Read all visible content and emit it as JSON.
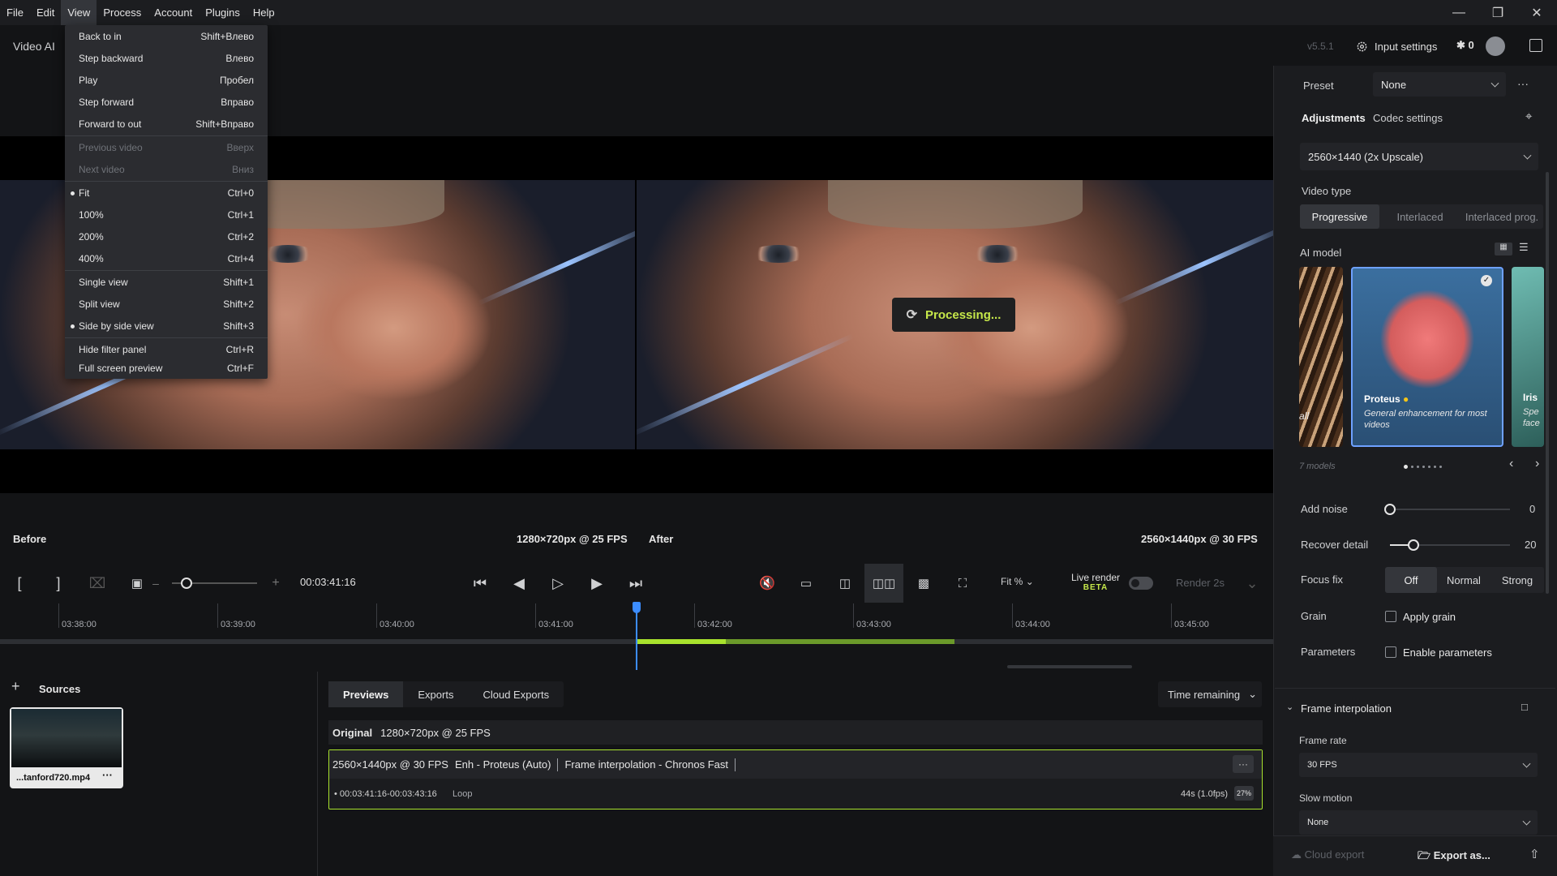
{
  "menubar": {
    "items": [
      "File",
      "Edit",
      "View",
      "Process",
      "Account",
      "Plugins",
      "Help"
    ],
    "active": "View"
  },
  "header": {
    "app_title": "Video AI",
    "version": "v5.5.1",
    "input_settings_label": "Input settings",
    "credits": "0"
  },
  "view_menu": {
    "items": [
      {
        "label": "Back to in",
        "shortcut": "Shift+Влево"
      },
      {
        "label": "Step backward",
        "shortcut": "Влево"
      },
      {
        "label": "Play",
        "shortcut": "Пробел"
      },
      {
        "label": "Step forward",
        "shortcut": "Вправо"
      },
      {
        "label": "Forward to out",
        "shortcut": "Shift+Вправо"
      },
      {
        "label": "Previous video",
        "shortcut": "Вверх"
      },
      {
        "label": "Next video",
        "shortcut": "Вниз"
      },
      {
        "label": "Fit",
        "shortcut": "Ctrl+0"
      },
      {
        "label": "100%",
        "shortcut": "Ctrl+1"
      },
      {
        "label": "200%",
        "shortcut": "Ctrl+2"
      },
      {
        "label": "400%",
        "shortcut": "Ctrl+4"
      },
      {
        "label": "Single view",
        "shortcut": "Shift+1"
      },
      {
        "label": "Split view",
        "shortcut": "Shift+2"
      },
      {
        "label": "Side by side view",
        "shortcut": "Shift+3"
      },
      {
        "label": "Hide filter panel",
        "shortcut": "Ctrl+R"
      },
      {
        "label": "Full screen preview",
        "shortcut": "Ctrl+F"
      }
    ]
  },
  "preview": {
    "processing_label": "Processing...",
    "before_label": "Before",
    "before_res": "1280×720px @ 25 FPS",
    "after_label": "After",
    "after_res": "2560×1440px @ 30 FPS"
  },
  "controls": {
    "timecode": "00:03:41:16",
    "zoom_mode": "Fit %",
    "live_render": "Live render",
    "beta": "BETA",
    "render_label": "Render 2s"
  },
  "timeline": {
    "ticks": [
      "03:38:00",
      "03:39:00",
      "03:40:00",
      "03:41:00",
      "03:42:00",
      "03:43:00",
      "03:44:00",
      "03:45:00"
    ]
  },
  "sources": {
    "title": "Sources",
    "file_name": "...tanford720.mp4"
  },
  "queue": {
    "tabs": [
      "Previews",
      "Exports",
      "Cloud Exports"
    ],
    "sort_label": "Time remaining",
    "original_label": "Original",
    "original_res": "1280×720px @ 25 FPS",
    "job_res": "2560×1440px @ 30 FPS",
    "job_enh": "Enh - Proteus (Auto)",
    "job_interp": "Frame interpolation -  Chronos Fast",
    "job_range": "00:03:41:16-00:03:43:16",
    "job_loop": "Loop",
    "job_eta": "44s (1.0fps)",
    "job_pct": "27%"
  },
  "panel": {
    "preset_label": "Preset",
    "preset_value": "None",
    "tab_adjustments": "Adjustments",
    "tab_codec": "Codec settings",
    "output_value": "2560×1440 (2x Upscale)",
    "video_type_label": "Video type",
    "video_types": [
      "Progressive",
      "Interlaced",
      "Interlaced prog."
    ],
    "ai_model_label": "AI model",
    "models": [
      {
        "name": "all",
        "desc": ""
      },
      {
        "name": "Proteus",
        "desc": "General enhancement for most videos"
      },
      {
        "name": "Iris",
        "desc": "Spe face"
      }
    ],
    "models_count": "7 models",
    "add_noise_label": "Add noise",
    "add_noise_value": "0",
    "recover_detail_label": "Recover detail",
    "recover_detail_value": "20",
    "focus_fix_label": "Focus fix",
    "focus_options": [
      "Off",
      "Normal",
      "Strong"
    ],
    "grain_label": "Grain",
    "apply_grain": "Apply grain",
    "parameters_label": "Parameters",
    "enable_parameters": "Enable parameters",
    "frame_interp_label": "Frame interpolation",
    "frame_rate_label": "Frame rate",
    "frame_rate_value": "30 FPS",
    "slow_motion_label": "Slow motion",
    "slow_motion_value": "None",
    "cloud_export": "Cloud export",
    "export_as": "Export as..."
  },
  "colors": {
    "accent": "#a8e22d",
    "playhead": "#3c8dff"
  }
}
